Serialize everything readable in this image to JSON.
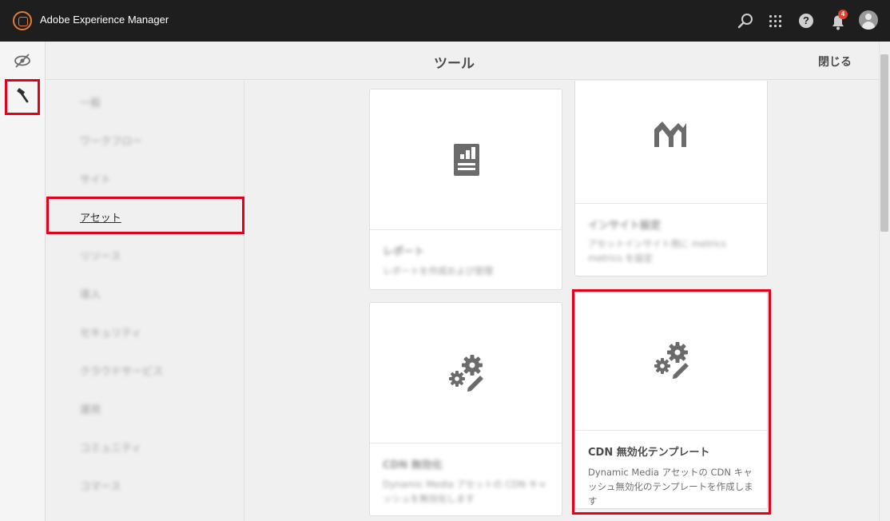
{
  "topbar": {
    "app_title": "Adobe Experience Manager",
    "notification_count": "4"
  },
  "header": {
    "title": "ツール",
    "close_label": "閉じる"
  },
  "categories": [
    {
      "label": "一般"
    },
    {
      "label": "ワークフロー"
    },
    {
      "label": "サイト"
    },
    {
      "label": "アセット",
      "active": true
    },
    {
      "label": "リソース"
    },
    {
      "label": "導入"
    },
    {
      "label": "セキュリティ"
    },
    {
      "label": "クラウドサービス"
    },
    {
      "label": "運用"
    },
    {
      "label": "コミュニティ"
    },
    {
      "label": "コマース"
    }
  ],
  "cards": [
    {
      "title": "レポート",
      "description": "レポートを作成および管理",
      "icon": "report-icon"
    },
    {
      "title": "インサイト設定",
      "description": "アセットインサイト用に metrics metrics を設定",
      "icon": "insights-chart-icon"
    },
    {
      "title": "CDN 無効化",
      "description": "Dynamic Media アセットの CDN キャッシュを無効化します",
      "icon": "gears-edit-icon"
    },
    {
      "title": "CDN 無効化テンプレート",
      "description": "Dynamic Media アセットの CDN キャッシュ無効化のテンプレートを作成します",
      "icon": "gears-edit-icon"
    }
  ],
  "colors": {
    "topbar": "#1e1e1e",
    "highlight": "#e2001a",
    "logo_accent": "#e37b3c",
    "badge": "#e0412b"
  }
}
